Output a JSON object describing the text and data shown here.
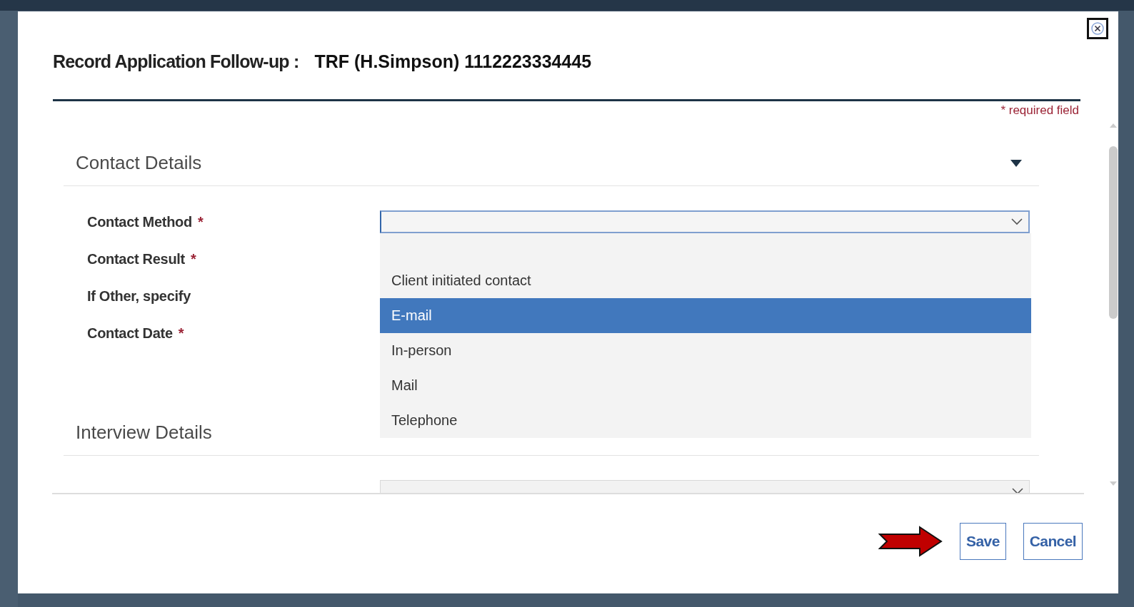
{
  "dialog": {
    "title": "Record Application Follow-up :",
    "subject": "TRF (H.Simpson) 1112223334445",
    "required_note": "* required field"
  },
  "sections": [
    {
      "title": "Contact Details",
      "expanded": true,
      "fields": [
        {
          "label": "Contact Method",
          "required_mark": "*",
          "kind": "select",
          "open": true,
          "options": [
            {
              "label": "Client initiated contact",
              "selected": false
            },
            {
              "label": "E-mail",
              "selected": true
            },
            {
              "label": "In-person",
              "selected": false
            },
            {
              "label": "Mail",
              "selected": false
            },
            {
              "label": "Telephone",
              "selected": false
            }
          ]
        },
        {
          "label": "Contact Result",
          "required_mark": "*"
        },
        {
          "label": "If Other, specify",
          "kind": "text"
        },
        {
          "label": "Contact Date",
          "required_mark": "*",
          "kind": "date"
        }
      ]
    },
    {
      "title": "Interview Details",
      "fields": [
        {
          "kind": "select"
        }
      ]
    }
  ],
  "buttons": [
    {
      "label": "Save",
      "pointed": true
    },
    {
      "label": "Cancel",
      "pointed": false
    }
  ]
}
